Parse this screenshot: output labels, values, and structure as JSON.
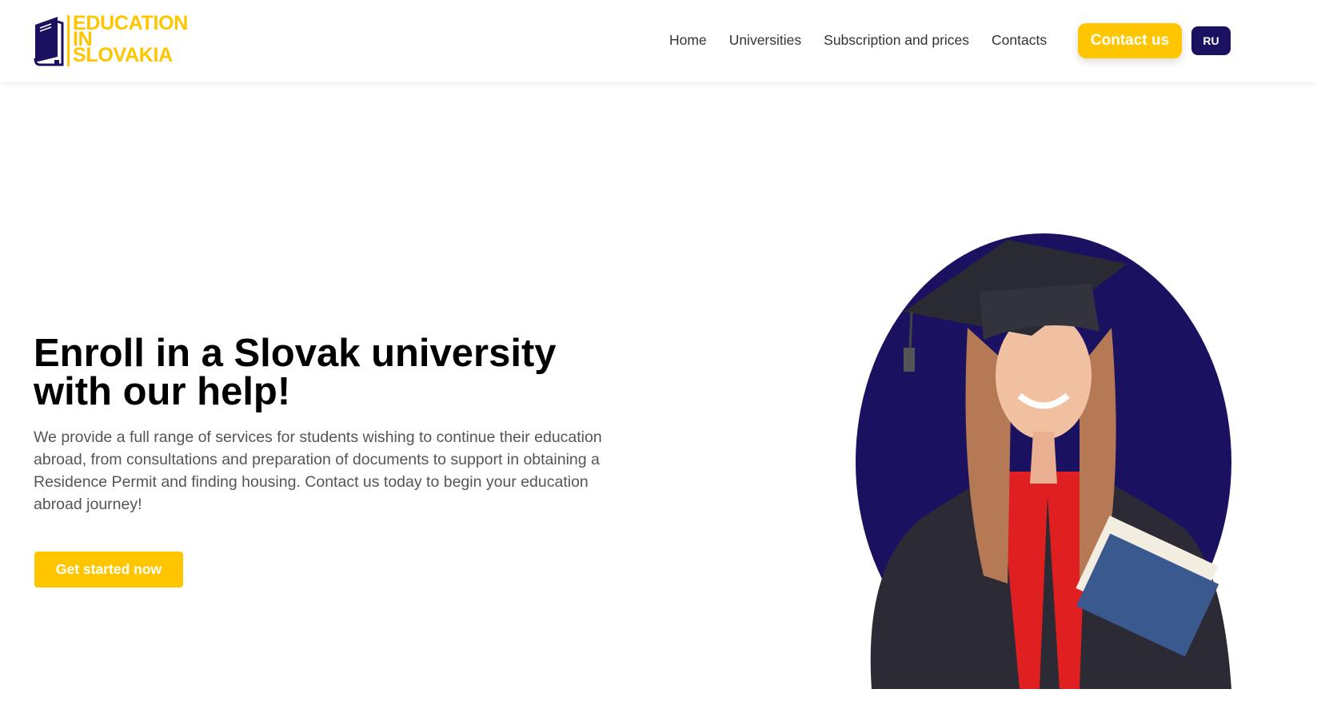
{
  "header": {
    "logo": {
      "line1": "EDUCATION",
      "line2": "IN",
      "line3": "SLOVAKIA",
      "icon": "book-icon"
    },
    "nav": [
      {
        "label": "Home"
      },
      {
        "label": "Universities"
      },
      {
        "label": "Subscription and prices"
      },
      {
        "label": "Contacts"
      }
    ],
    "contact_button": "Contact us",
    "language": "RU"
  },
  "hero": {
    "title": "Enroll in a Slovak university with our help!",
    "description": "We provide a full range of services for students wishing to continue their education abroad, from consultations and preparation of documents to support in obtaining a Residence Permit and finding housing. Contact us today to begin your education abroad journey!",
    "cta": "Get started now"
  },
  "colors": {
    "accent": "#ffc600",
    "brand": "#1a1160"
  }
}
